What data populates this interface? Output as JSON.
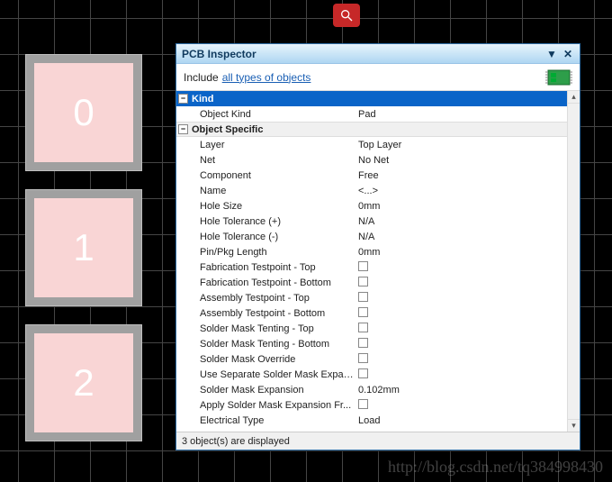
{
  "pads": [
    "0",
    "1",
    "2"
  ],
  "inspector": {
    "title": "PCB Inspector",
    "include_label": "Include",
    "include_link": "all types of objects",
    "groups": {
      "kind": {
        "title": "Kind"
      },
      "obj_specific": {
        "title": "Object Specific"
      }
    },
    "rows": {
      "object_kind": {
        "label": "Object Kind",
        "value": "Pad"
      },
      "layer": {
        "label": "Layer",
        "value": "Top Layer"
      },
      "net": {
        "label": "Net",
        "value": "No Net"
      },
      "component": {
        "label": "Component",
        "value": "Free"
      },
      "name": {
        "label": "Name",
        "value": "<...>"
      },
      "hole_size": {
        "label": "Hole Size",
        "value": "0mm"
      },
      "hole_tol_p": {
        "label": "Hole Tolerance (+)",
        "value": "N/A"
      },
      "hole_tol_m": {
        "label": "Hole Tolerance (-)",
        "value": "N/A"
      },
      "pin_pkg": {
        "label": "Pin/Pkg Length",
        "value": "0mm"
      },
      "fab_tp_top": {
        "label": "Fabrication Testpoint - Top"
      },
      "fab_tp_bot": {
        "label": "Fabrication Testpoint - Bottom"
      },
      "asm_tp_top": {
        "label": "Assembly Testpoint - Top"
      },
      "asm_tp_bot": {
        "label": "Assembly Testpoint - Bottom"
      },
      "smt_top": {
        "label": "Solder Mask Tenting - Top"
      },
      "smt_bot": {
        "label": "Solder Mask Tenting - Bottom"
      },
      "sm_override": {
        "label": "Solder Mask Override"
      },
      "use_sep_sm": {
        "label": "Use Separate Solder Mask Expan..."
      },
      "sm_exp": {
        "label": "Solder Mask Expansion",
        "value": "0.102mm"
      },
      "apply_sm": {
        "label": "Apply Solder Mask Expansion Fr..."
      },
      "elec_type": {
        "label": "Electrical Type",
        "value": "Load"
      }
    },
    "status": "3 object(s) are displayed"
  },
  "watermark": "http://blog.csdn.net/tq384998430"
}
